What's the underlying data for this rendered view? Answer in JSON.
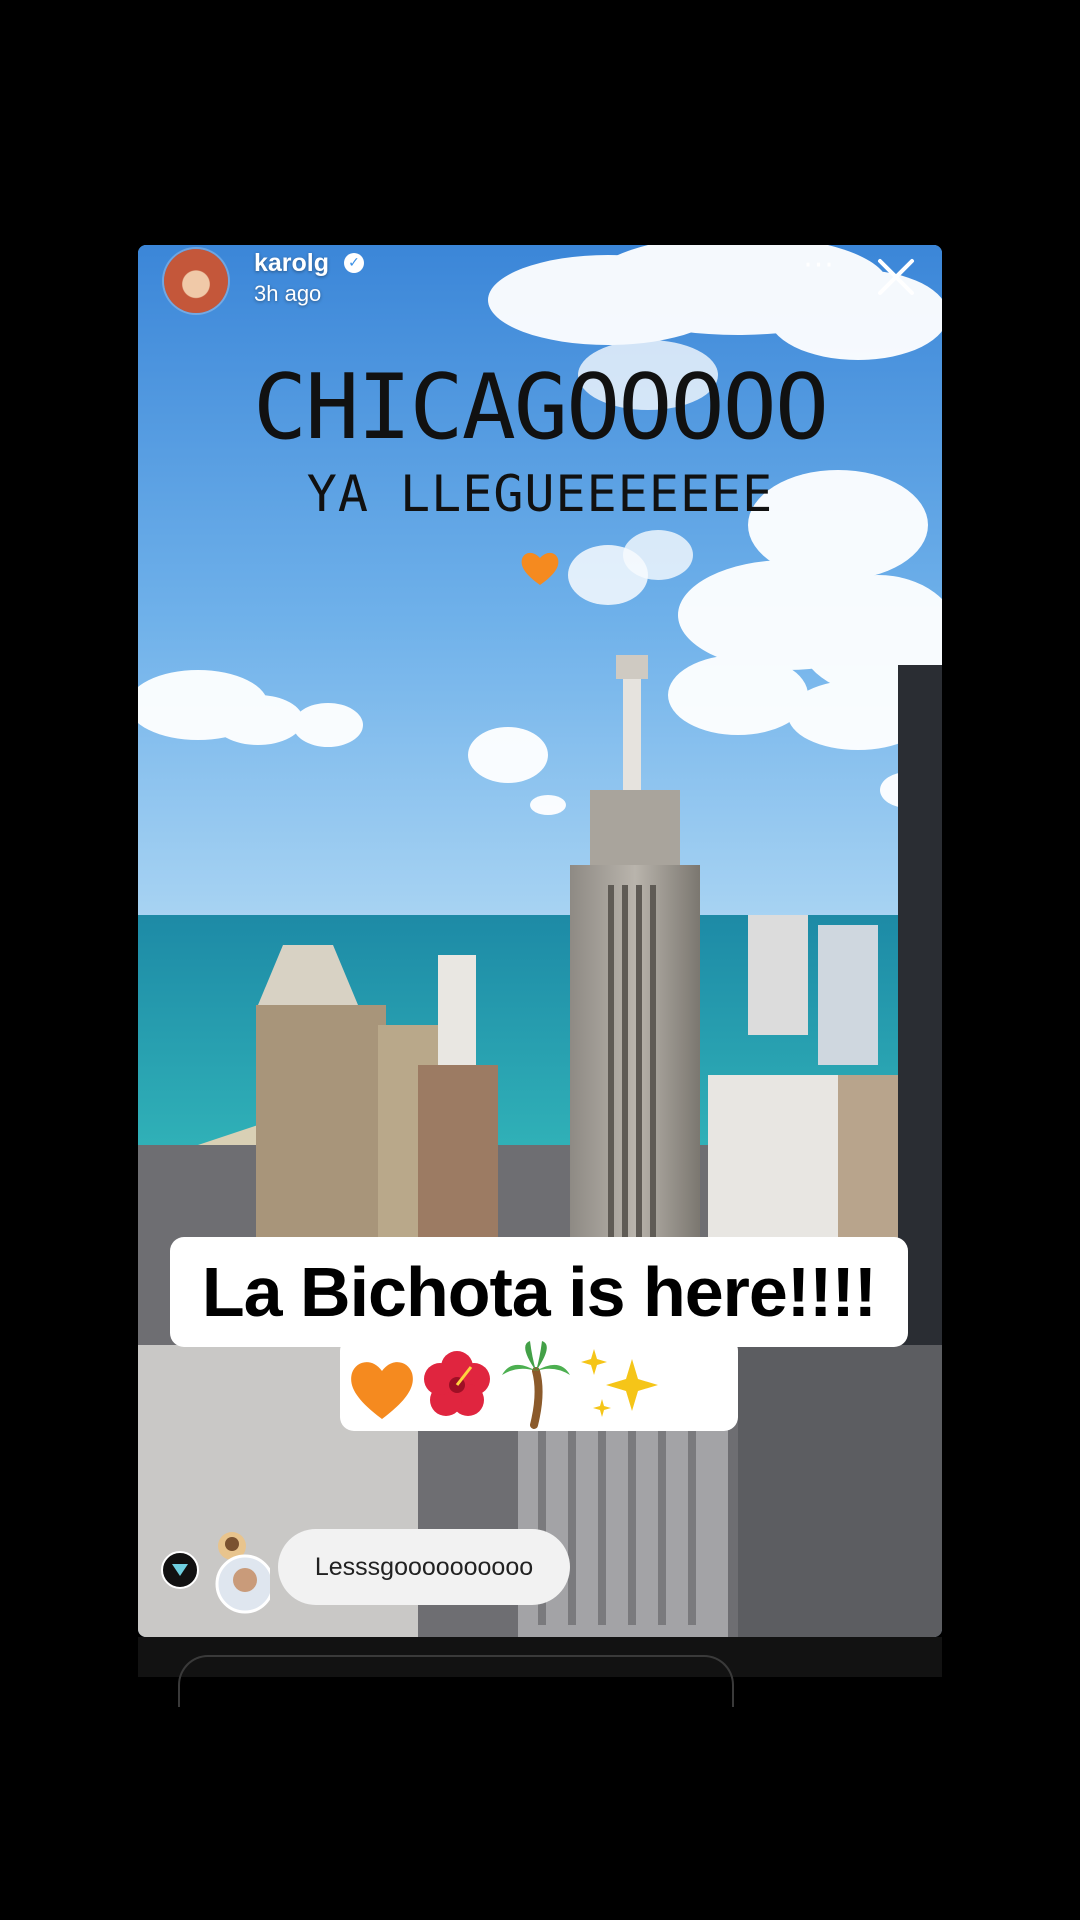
{
  "story": {
    "username": "karolg",
    "time_ago": "3h ago",
    "headline": "CHICAGOOOOO",
    "subline": "YA LLEGUEEEEEEE",
    "caption": "La Bichota is here!!!!",
    "emoji_line": "🧡🌺🌴✨",
    "reply_text": "Lesssgoooooooooo"
  },
  "colors": {
    "background": "#000000",
    "sky": "#5fa2e0",
    "lake": "#2fb0b8",
    "caption_bg": "#ffffff",
    "heart": "#f58a1f"
  },
  "icons": {
    "verified": "verified-badge-icon",
    "more": "more-dots-icon",
    "close": "close-icon",
    "heart": "orange-heart-icon"
  }
}
